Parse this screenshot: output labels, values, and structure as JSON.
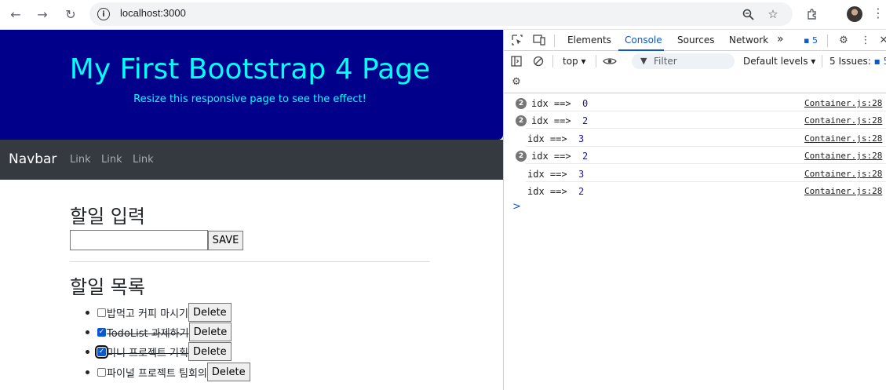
{
  "browser": {
    "url": "localhost:3000",
    "info_icon": "info-icon"
  },
  "page": {
    "jumbotron": {
      "title": "My First Bootstrap 4 Page",
      "subtitle": "Resize this responsive page to see the effect!",
      "bg_color": "#00008b",
      "text_color": "#00ffff"
    },
    "navbar": {
      "brand": "Navbar",
      "links": [
        "Link",
        "Link",
        "Link"
      ],
      "bg_color": "#343a40"
    },
    "input_section": {
      "heading": "할일 입력",
      "input_value": "",
      "save_label": "SAVE"
    },
    "list_section": {
      "heading": "할일 목록",
      "items": [
        {
          "text": "밥먹고 커피 마시기",
          "checked": false,
          "done": false,
          "delete_label": "Delete"
        },
        {
          "text": "TodoList 과제하기",
          "checked": true,
          "done": true,
          "delete_label": "Delete"
        },
        {
          "text": "미니 프로젝트 기획",
          "checked": true,
          "done": true,
          "delete_label": "Delete"
        },
        {
          "text": "파이널 프로젝트 팀회의",
          "checked": false,
          "done": false,
          "delete_label": "Delete"
        }
      ]
    }
  },
  "devtools": {
    "tabs": [
      "Elements",
      "Console",
      "Sources",
      "Network"
    ],
    "active_tab": "Console",
    "more_tabs": "»",
    "message_count": "5",
    "toolbar": {
      "context": "top",
      "filter_placeholder": "Filter",
      "levels": "Default levels",
      "issues": "5 Issues:",
      "issues_count": "5"
    },
    "logs": [
      {
        "repeat": "2",
        "label": "idx ==> ",
        "value": "0",
        "source": "Container.js:28"
      },
      {
        "repeat": "2",
        "label": "idx ==> ",
        "value": "2",
        "source": "Container.js:28"
      },
      {
        "repeat": "",
        "label": "idx ==> ",
        "value": "3",
        "source": "Container.js:28"
      },
      {
        "repeat": "2",
        "label": "idx ==> ",
        "value": "2",
        "source": "Container.js:28"
      },
      {
        "repeat": "",
        "label": "idx ==> ",
        "value": "3",
        "source": "Container.js:28"
      },
      {
        "repeat": "",
        "label": "idx ==> ",
        "value": "2",
        "source": "Container.js:28"
      }
    ],
    "prompt": ">"
  }
}
